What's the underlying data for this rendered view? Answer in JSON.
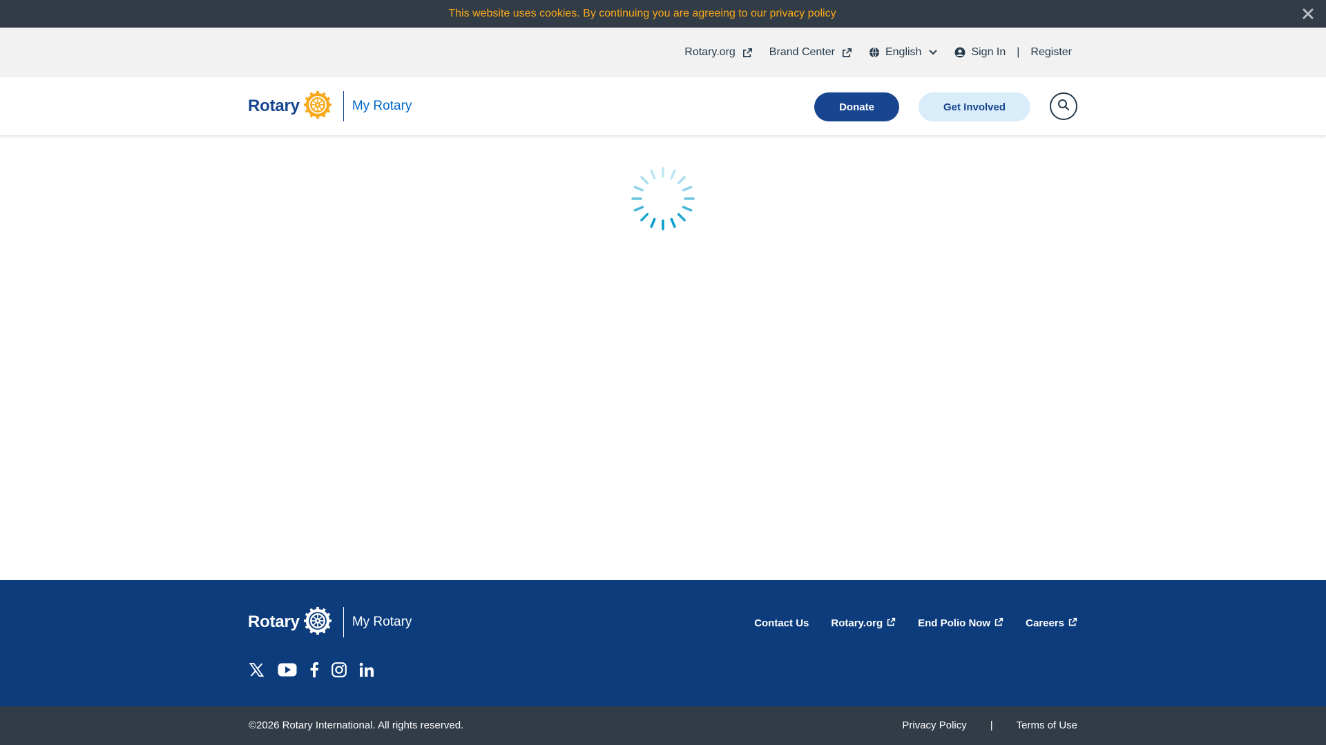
{
  "cookie_bar": {
    "message": "This website uses cookies. By continuing you are agreeing to our privacy policy",
    "close_icon": "close-icon"
  },
  "utility_nav": {
    "rotary_org": "Rotary.org",
    "brand_center": "Brand Center",
    "language": "English",
    "sign_in": "Sign In",
    "separator": "|",
    "register": "Register"
  },
  "header": {
    "logo_word": "Rotary",
    "site_name": "My Rotary",
    "donate": "Donate",
    "get_involved": "Get Involved",
    "search_icon": "search-icon"
  },
  "main": {
    "loading_indicator": "spinner"
  },
  "footer": {
    "logo_word": "Rotary",
    "site_name": "My Rotary",
    "links": {
      "contact": "Contact Us",
      "rotary_org": "Rotary.org",
      "end_polio": "End Polio Now",
      "careers": "Careers"
    },
    "social": [
      "x-icon",
      "youtube-icon",
      "facebook-icon",
      "instagram-icon",
      "linkedin-icon"
    ]
  },
  "bottom_bar": {
    "copyright": "©2026 Rotary International. All rights reserved.",
    "privacy": "Privacy Policy",
    "separator": "|",
    "terms": "Terms of Use"
  },
  "colors": {
    "brand_blue": "#17458f",
    "gold": "#f7a81b",
    "dark_bar": "#323c47",
    "footer_blue": "#0c3c7c",
    "light_blue_button": "#d9ecfa",
    "spinner": "#0099cc"
  }
}
